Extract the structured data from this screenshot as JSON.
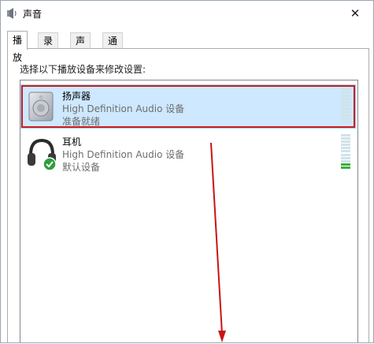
{
  "window": {
    "title": "声音",
    "close_glyph": "✕"
  },
  "tabs": [
    {
      "label": "播放",
      "active": true
    },
    {
      "label": "录制",
      "active": false
    },
    {
      "label": "声音",
      "active": false
    },
    {
      "label": "通信",
      "active": false
    }
  ],
  "instruction": "选择以下播放设备来修改设置:",
  "devices": [
    {
      "name": "扬声器",
      "description": "High Definition Audio 设备",
      "status": "准备就绪",
      "selected": true,
      "icon": "speaker-icon",
      "level": 0
    },
    {
      "name": "耳机",
      "description": "High Definition Audio 设备",
      "status": "默认设备",
      "selected": false,
      "icon": "headphones-icon",
      "badge": "default-check-icon",
      "level": 0.15
    }
  ],
  "colors": {
    "selection_bg": "#cde8ff",
    "highlight_border": "#d01c1c",
    "arrow": "#c81414",
    "level_active": "#3fae3f"
  }
}
